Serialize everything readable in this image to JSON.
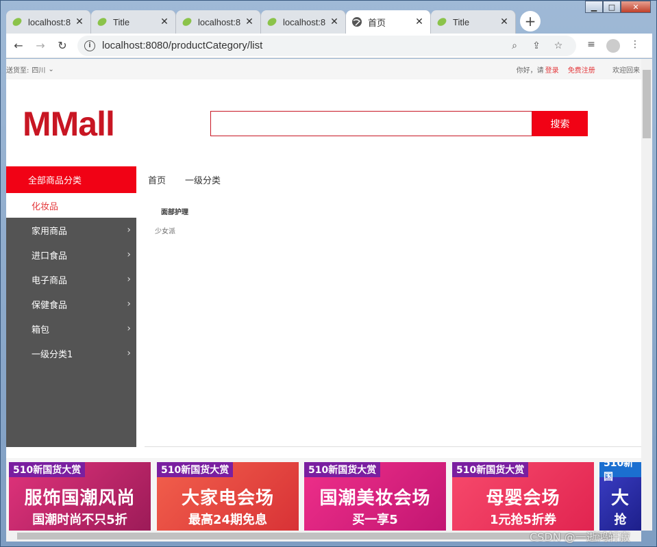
{
  "browser": {
    "tabs": [
      {
        "title": "localhost:8",
        "favicon": "spring-leaf-icon",
        "active": false
      },
      {
        "title": "Title",
        "favicon": "spring-leaf-icon",
        "active": false
      },
      {
        "title": "localhost:8",
        "favicon": "spring-leaf-icon",
        "active": false
      },
      {
        "title": "localhost:8",
        "favicon": "spring-leaf-icon",
        "active": false
      },
      {
        "title": "首页",
        "favicon": "globe-icon",
        "active": true
      },
      {
        "title": "Title",
        "favicon": "spring-leaf-icon",
        "active": false
      }
    ],
    "url": "localhost:8080/productCategory/list"
  },
  "topbar": {
    "ship_to_label": "送货至:",
    "ship_to_value": "四川",
    "greeting": "你好，请",
    "login": "登录",
    "register": "免费注册",
    "welcome": "欢迎回来"
  },
  "header": {
    "logo": "MMall",
    "search_button": "搜索",
    "search_value": ""
  },
  "categories": {
    "title": "全部商品分类",
    "items": [
      {
        "label": "化妆品",
        "active": true
      },
      {
        "label": "家用商品",
        "active": false
      },
      {
        "label": "进口食品",
        "active": false
      },
      {
        "label": "电子商品",
        "active": false
      },
      {
        "label": "保健食品",
        "active": false
      },
      {
        "label": "箱包",
        "active": false
      },
      {
        "label": "一级分类1",
        "active": false
      }
    ]
  },
  "breadcrumbs": [
    "首页",
    "一级分类"
  ],
  "subcategory": {
    "title": "面部护理",
    "item": "少女派"
  },
  "banners": [
    {
      "tag": "510新国货大赏",
      "headline": "服饰国潮风尚",
      "sub": "国潮时尚不只5折",
      "color": "#c2195e"
    },
    {
      "tag": "510新国货大赏",
      "headline": "大家电会场",
      "sub": "最高24期免息",
      "color": "#e8453c"
    },
    {
      "tag": "510新国货大赏",
      "headline": "国潮美妆会场",
      "sub": "买一享5",
      "color": "#d61f7a"
    },
    {
      "tag": "510新国货大赏",
      "headline": "母婴会场",
      "sub": "1元抢5折券",
      "color": "#ef3d5e"
    },
    {
      "tag": "510新国",
      "headline": "大",
      "sub": "抢",
      "color": "#2b2fa8"
    }
  ],
  "watermark": "CSDN @一逝鸿轩寂"
}
